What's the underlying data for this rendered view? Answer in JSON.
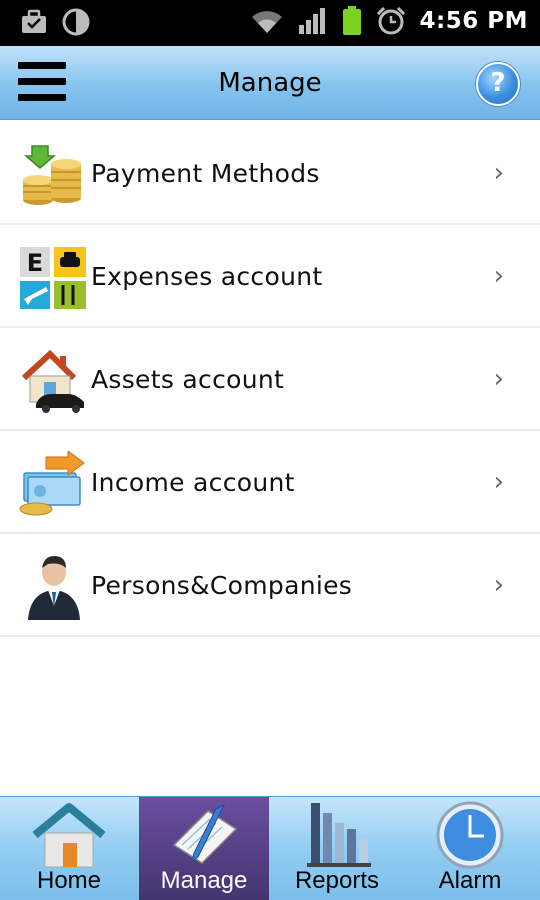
{
  "status_bar": {
    "time": "4:56 PM",
    "icons": [
      "briefcase-icon",
      "sync-icon",
      "wifi-icon",
      "signal-icon",
      "battery-icon",
      "alarm-icon"
    ]
  },
  "header": {
    "title": "Manage",
    "menu_icon": "hamburger-icon",
    "help_icon": "help-icon",
    "help_glyph": "?"
  },
  "menu": {
    "items": [
      {
        "label": "Payment Methods",
        "icon": "coins-icon"
      },
      {
        "label": "Expenses account",
        "icon": "expenses-icon"
      },
      {
        "label": "Assets account",
        "icon": "house-car-icon"
      },
      {
        "label": "Income account",
        "icon": "income-icon"
      },
      {
        "label": "Persons&Companies",
        "icon": "person-icon"
      }
    ],
    "chevron": "›"
  },
  "tabs": [
    {
      "label": "Home",
      "icon": "home-icon",
      "active": false
    },
    {
      "label": "Manage",
      "icon": "notepad-icon",
      "active": true
    },
    {
      "label": "Reports",
      "icon": "bar-chart-icon",
      "active": false
    },
    {
      "label": "Alarm",
      "icon": "clock-icon",
      "active": false
    }
  ],
  "colors": {
    "header_gradient": "#86c3ee",
    "active_tab": "#4e3c80",
    "divider": "#ececec"
  }
}
